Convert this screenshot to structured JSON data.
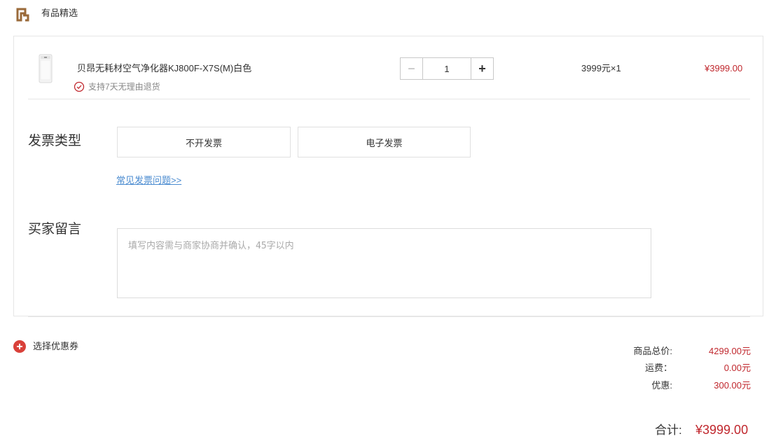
{
  "store": {
    "logo_icon": "shop-logo-icon",
    "name": "有品精选"
  },
  "product": {
    "image_icon": "air-purifier-image",
    "title": "贝昂无耗材空气净化器KJ800F-X7S(M)白色",
    "return_icon": "check-circle-icon",
    "return_policy": "支持7天无理由退货",
    "quantity": "1",
    "unit_price_text": "3999元×1",
    "line_total": "¥3999.00"
  },
  "invoice": {
    "label": "发票类型",
    "options": [
      "不开发票",
      "电子发票"
    ],
    "faq_link": "常见发票问题>>"
  },
  "message": {
    "label": "买家留言",
    "placeholder": "填写内容需与商家协商并确认，45字以内",
    "value": ""
  },
  "coupon": {
    "icon": "plus-circle-icon",
    "label": "选择优惠券"
  },
  "summary": {
    "goods_total_label": "商品总价:",
    "goods_total_value": "4299.00元",
    "shipping_label": "运费：",
    "shipping_value": "0.00元",
    "discount_label": "优惠:",
    "discount_value": "300.00元",
    "total_label": "合计:",
    "total_value": "¥3999.00"
  },
  "colors": {
    "price_red": "#c0272d",
    "link_blue": "#4a8bd0",
    "logo_brown": "#9a6a3a",
    "coupon_red": "#d9413a"
  }
}
